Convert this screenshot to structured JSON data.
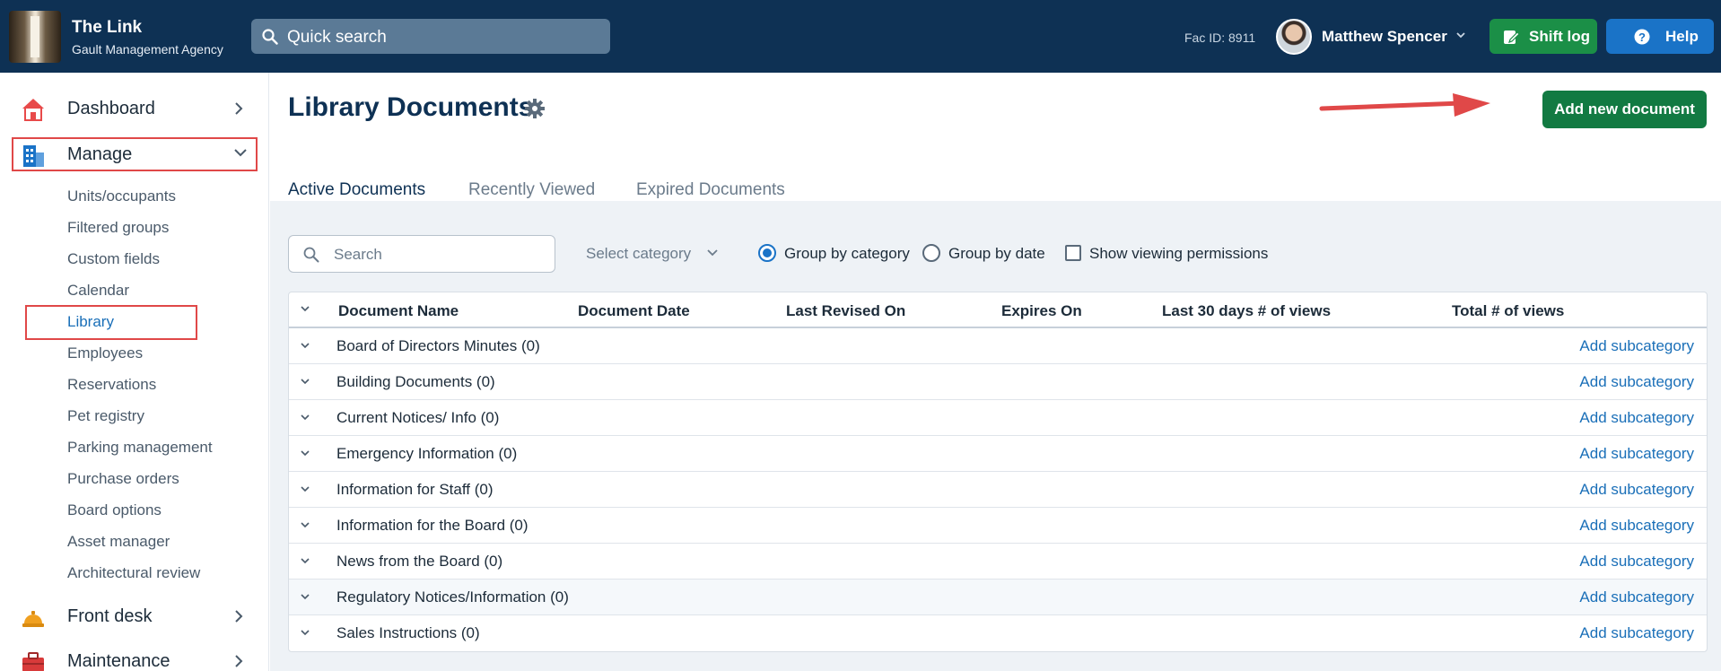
{
  "header": {
    "brand_title": "The Link",
    "brand_subtitle": "Gault Management Agency",
    "search_label": "Quick search",
    "fac_id": "Fac ID: 8911",
    "user_name": "Matthew Spencer",
    "shift_log_label": "Shift log",
    "help_label": "Help"
  },
  "sidebar": {
    "main": [
      {
        "label": "Dashboard"
      },
      {
        "label": "Manage"
      },
      {
        "label": "Front desk"
      },
      {
        "label": "Maintenance"
      }
    ],
    "sub_items": [
      "Units/occupants",
      "Filtered groups",
      "Custom fields",
      "Calendar",
      "Library",
      "Employees",
      "Reservations",
      "Pet registry",
      "Parking management",
      "Purchase orders",
      "Board options",
      "Asset manager",
      "Architectural review"
    ],
    "active_sub_item": "Library"
  },
  "main": {
    "title": "Library Documents",
    "add_button": "Add new document",
    "tabs": [
      "Active Documents",
      "Recently Viewed",
      "Expired Documents"
    ],
    "active_tab": "Active Documents",
    "filters": {
      "search_placeholder": "Search",
      "category_select": "Select category",
      "group_by_category": "Group by category",
      "group_by_date": "Group by date",
      "show_permissions": "Show viewing permissions",
      "selected_grouping": "Group by category"
    },
    "table": {
      "columns": [
        "Document Name",
        "Document Date",
        "Last Revised On",
        "Expires On",
        "Last 30 days # of views",
        "Total # of views"
      ],
      "rows": [
        "Board of Directors Minutes (0)",
        "Building Documents (0)",
        "Current Notices/ Info (0)",
        "Emergency Information (0)",
        "Information for Staff (0)",
        "Information for the Board (0)",
        "News from the Board (0)",
        "Regulatory Notices/Information (0)",
        "Sales Instructions (0)"
      ],
      "row_action": "Add subcategory"
    }
  },
  "colors": {
    "topbar": "#0e3154",
    "accent_blue": "#1a73c7",
    "green": "#127a42",
    "annotation_red": "#e04848"
  }
}
